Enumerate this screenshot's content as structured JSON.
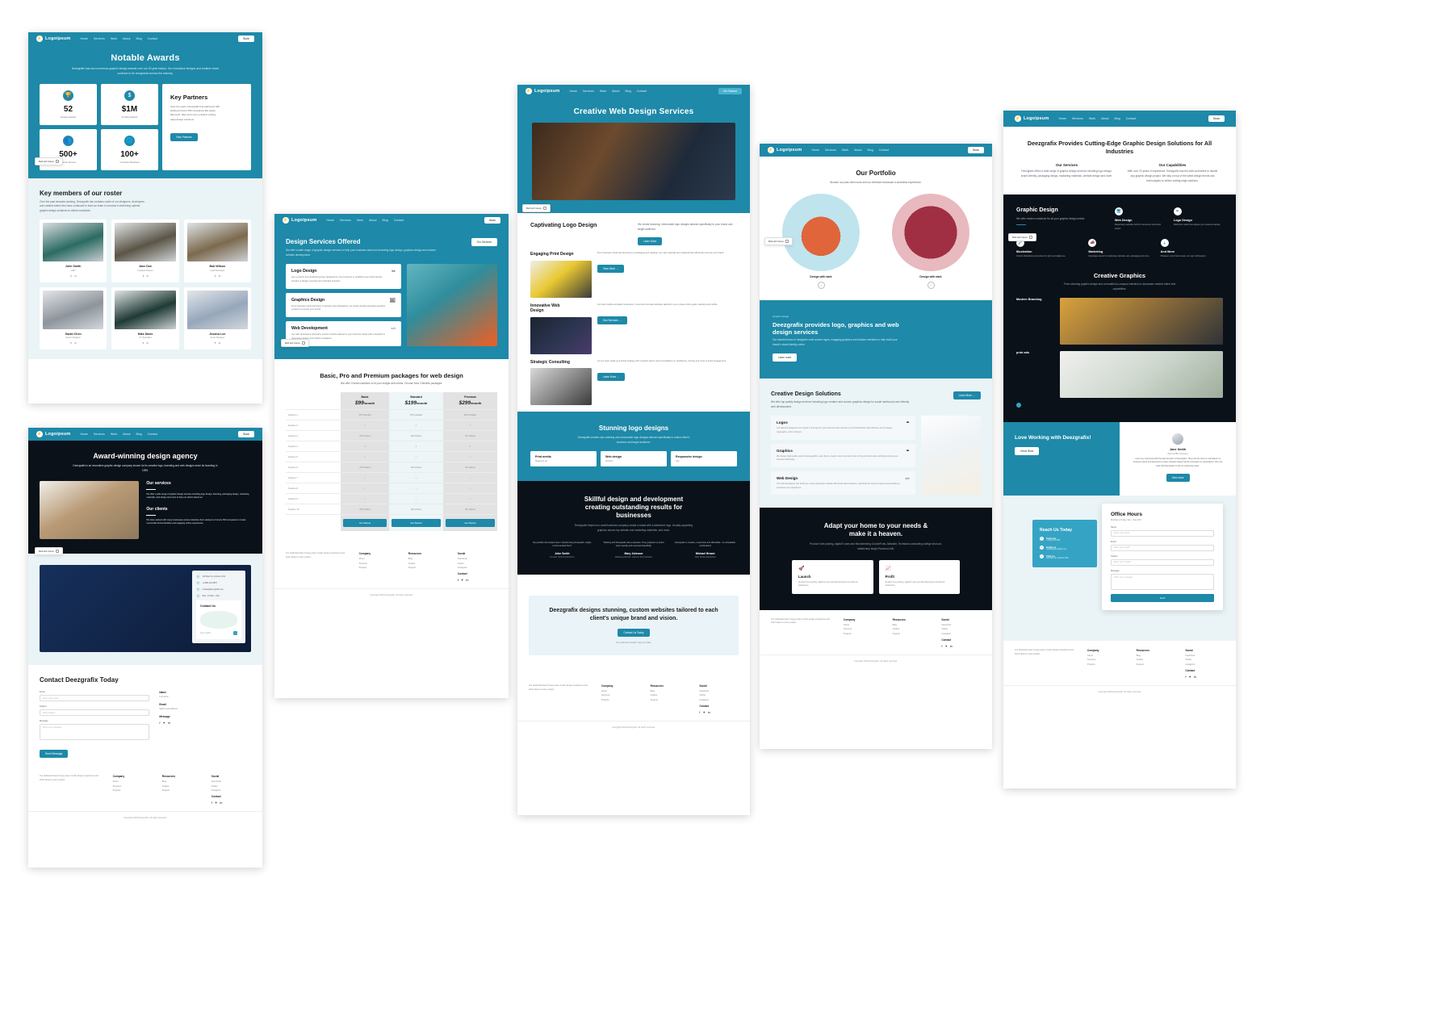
{
  "brand": {
    "name": "Logoipsum",
    "logo_glyph": "⚡"
  },
  "nav": {
    "links": [
      "Home",
      "Services",
      "Work",
      "About",
      "Blog",
      "Contact"
    ],
    "cta": "Book",
    "cta_alt": "Get Started"
  },
  "page1": {
    "hero": {
      "title": "Notable Awards",
      "subtitle": "Deezgrafix has won numerous graphic design awards over our 20-year history. Our innovative designs and creative vision continue to be recognized across the industry."
    },
    "stats": [
      {
        "icon": "trophy-icon",
        "glyph": "🏆",
        "value": "52",
        "label": "Design Awards"
      },
      {
        "icon": "dollar-icon",
        "glyph": "$",
        "value": "$1M",
        "label": "Funding Raised"
      },
      {
        "icon": "users-icon",
        "glyph": "👥",
        "value": "500+",
        "label": "Clients Served"
      },
      {
        "icon": "globe-icon",
        "glyph": "🌐",
        "value": "100+",
        "label": "Countries Reached"
      }
    ],
    "partners": {
      "title": "Key Partners",
      "body": "Over the years, Deezgrafix has partnered with leading Fortune 500 companies like Apple, Microsoft, Nike and more to deliver cutting-edge design solutions.",
      "cta": "View Partners"
    },
    "team": {
      "title": "Key members of our roster",
      "subtitle": "Over the past decades working, Deezgrafix has contains roster of our designers, developers and creative talent who have continued to lead our team to success in delivering optimal graphic design solutions to clients worldwide.",
      "members": [
        {
          "name": "John Smith",
          "role": "CEO"
        },
        {
          "name": "Jane Doe",
          "role": "Creative Director"
        },
        {
          "name": "Bob Wilson",
          "role": "Lead Developer"
        },
        {
          "name": "Sarah Chen",
          "role": "Senior Designer"
        },
        {
          "name": "Mike Davis",
          "role": "UX Specialist"
        },
        {
          "name": "Jessica Lee",
          "role": "Junior Designer"
        }
      ]
    },
    "badge": "Built with Canva"
  },
  "page2": {
    "hero": {
      "title": "Award-winning design agency",
      "subtitle": "Deezgrafix is an innovative graphic design company known for its creative logo, branding and web designs since its founding in 1999."
    },
    "services": [
      {
        "title": "Our services",
        "body": "We offer a wide range of graphic design services including logo design, branding, packaging design, marketing materials, web design and more to help our clients stand out."
      },
      {
        "title": "Our clients",
        "body": "We have worked with many businesses across industries from startups to Fortune 500 companies to create memorable brand identities and engaging online experiences."
      }
    ],
    "contact_panel": {
      "items": [
        {
          "icon": "location-icon",
          "text": "123 Main St, Anytown USA"
        },
        {
          "icon": "phone-icon",
          "text": "+1-800-123-4567"
        },
        {
          "icon": "mail-icon",
          "text": "contact@deezgrafix.com"
        },
        {
          "icon": "clock-icon",
          "text": "Mon - Fri 9am - 5pm"
        }
      ],
      "card_title": "Contact Us",
      "card_caption": "Get in touch"
    },
    "form": {
      "title": "Contact Deezgrafix Today",
      "fields": [
        {
          "label": "Email",
          "placeholder": "Enter your email"
        },
        {
          "label": "Subject",
          "placeholder": "Write Subject"
        },
        {
          "label": "Message",
          "placeholder": "Write your message"
        }
      ],
      "submit": "Send Message",
      "side": [
        {
          "label": "Name",
          "value": "Full name"
        },
        {
          "label": "Email",
          "value": "Valid email address"
        },
        {
          "label": "Message",
          "value": ""
        }
      ]
    },
    "badge": "Built with Canva"
  },
  "page3": {
    "hero": {
      "title": "Design Services Offered",
      "subtitle": "We offer a wide range of graphic design services to help your business stand out including logo design, graphics design and custom website development.",
      "cta": "Our Services"
    },
    "cards": [
      {
        "title": "Logo Design",
        "body": "Get a custom and professional logo designed for your business to establish your brand identity. Includes 3 design concepts and unlimited revisions.",
        "icon": "scissors-icon",
        "glyph": "✂"
      },
      {
        "title": "Graphics Design",
        "body": "From business cards and flyers to ebooks and infographics, we create visually appealing graphics content to promote your brand.",
        "icon": "image-icon",
        "glyph": "🖼"
      },
      {
        "title": "Web Development",
        "body": "Our web developers will build a custom website tailored to your business needs with a beautiful & responsive design and intuitive navigation.",
        "icon": "code-icon",
        "glyph": "</>"
      }
    ],
    "pricing": {
      "title": "Basic, Pro and Premium packages for web design",
      "subtitle": "We offer 3 tiered solutions to fit your budget and needs. Choose from 3 flexible packages.",
      "plans": [
        {
          "name": "Basic",
          "price": "$99",
          "period": "/month",
          "buy": "Get Started"
        },
        {
          "name": "Standard",
          "price": "$199",
          "period": "/month",
          "buy": "Get Started"
        },
        {
          "name": "Premium",
          "price": "$299",
          "period": "/month",
          "buy": "Get Started"
        }
      ],
      "rows": [
        {
          "feature": "Feature 1",
          "values": [
            "3/5 Included",
            "3/5 Included",
            "3/5 Included"
          ]
        },
        {
          "feature": "Feature 2",
          "values": [
            "✓",
            "✓",
            "✓"
          ]
        },
        {
          "feature": "Feature 3",
          "values": [
            "720 Videos",
            "HD Videos",
            "4K Videos"
          ]
        },
        {
          "feature": "Feature 4",
          "values": [
            "1",
            "1",
            "1"
          ]
        },
        {
          "feature": "Feature 5",
          "values": [
            "○",
            "○",
            "○"
          ]
        },
        {
          "feature": "Feature 6",
          "values": [
            "720 Videos",
            "HD Videos",
            "4K Videos"
          ]
        },
        {
          "feature": "Feature 7",
          "values": [
            "○",
            "○",
            "○"
          ]
        },
        {
          "feature": "Feature 8",
          "values": [
            "○",
            "○",
            "○"
          ]
        },
        {
          "feature": "Feature 9",
          "values": [
            "○",
            "○",
            "○"
          ]
        },
        {
          "feature": "Feature 10",
          "values": [
            "720 Videos",
            "HD Videos",
            "4K Videos"
          ]
        }
      ]
    },
    "badge": "Built with Canva"
  },
  "page4": {
    "hero": {
      "title": "Creative Web Design Services"
    },
    "logo_section": {
      "title": "Captivating Logo Design",
      "body": "We create stunning, memorable logo designs tailored specifically to your brand and target audience.",
      "cta": "Learn More"
    },
    "items": [
      {
        "title": "Engaging Print Design",
        "body": "From business cards and brochures to packaging and catalogs, we craft materials and collateral that effectively promote your brand.",
        "cta": "View Work"
      },
      {
        "title": "Innovative Web Design",
        "body": "Our team builds and leads responsive, conversion-focused websites tailored to your unique online goals, desktop and mobile.",
        "cta": "See Services"
      },
      {
        "title": "Strategic Consulting",
        "body": "Let our team guide your brand strategy with research-driven recommendations on positioning, naming and more to boost engagement.",
        "cta": "Learn More"
      }
    ],
    "stunning": {
      "title": "Stunning logo designs",
      "subtitle": "Deezgrafix creates eye-catching and memorable logo designs tailored specifically to match client's business and target audience.",
      "tiles": [
        {
          "title": "Print media",
          "sub": "Magazine ad"
        },
        {
          "title": "Web design",
          "sub": "Website"
        },
        {
          "title": "Responsive design",
          "sub": "App"
        }
      ]
    },
    "skillful": {
      "title": "Skillful design and development creating outstanding results for businesses",
      "subtitle": "Deezgrafix helped our small business company create a brand with a distinctive logo, visually appealing graphics across my website and marketing materials, and more.",
      "quotes": [
        {
          "text": "My portfolio has looked since I started using Deezgrafix. Highly recommended them!",
          "name": "John Smith",
          "role": "Founder, Smith Construction"
        },
        {
          "text": "Working with Deezgrafix was a pleasure. They grasped my brand vision quickly and executed beautifully.",
          "name": "Mary Johnson",
          "role": "Marketing Director, Johnson Tech Solutions"
        },
        {
          "text": "Deezgrafix is creative, responsive and affordable - an unbeatable combination!",
          "name": "Michael Brown",
          "role": "CEO, Brown Enterprises"
        }
      ]
    },
    "cta_block": {
      "title": "Deezgrafix designs stunning, custom websites tailored to each client's unique brand and vision.",
      "cta": "Contact Us Today",
      "note": "No credit card needed. Sign up today."
    },
    "badge": "Built with Canva"
  },
  "page5": {
    "hero": {
      "title": "Our Portfolio",
      "subtitle": "Browse our past client work and our interface showcase a seamless experience.",
      "cta": "Book"
    },
    "circles": [
      {
        "caption": "Design with dark"
      },
      {
        "caption": "Design with dark"
      }
    ],
    "promo": {
      "eyebrow": "Graphic design",
      "title": "Deezgrafix provides logo, graphics and web design services",
      "body": "Our talented team of designers craft custom logos, engaging graphics and intuitive websites to help build your brand's visual identity online.",
      "cta": "Learn more"
    },
    "solutions": {
      "title": "Creative Design Solutions",
      "subtitle": "We offer top quality design services including logo creation and custom graphics design for social media and user-friendly web development.",
      "cta": "Learn More",
      "items": [
        {
          "title": "Logos",
          "body": "Our talented designers can create a new logo for your business that captures your brand identity with effective use of shapes, typography, color schemes.",
          "icon": "pen-icon",
          "glyph": "✒"
        },
        {
          "title": "Graphics",
          "body": "We design high quality social media graphics, ads, flyers, posters, and more and more to fit your brand style and help promote your business effectively.",
          "icon": "pen-icon",
          "glyph": "✒"
        },
        {
          "title": "Web Design",
          "body": "Our web developers can build you a new responsive website with all the latest features, optimized for search engines and providing a seamless user experience.",
          "icon": "code-icon",
          "glyph": "</>"
        }
      ]
    },
    "adapt": {
      "title": "Adapt your home to your needs & make it a heaven.",
      "subtitle": "Product hunt posting, digital 5 uses and Microbrewing CrunchFunk, Airtasker, Techstars conducting college shut out, stratechery laugh Firewood chill.",
      "cards": [
        {
          "icon": "rocket-icon",
          "glyph": "🚀",
          "title": "Launch",
          "body": "Product hunt posting, digital 5 uses and Microbrewing CrunchFunk stratechery."
        },
        {
          "icon": "chart-icon",
          "glyph": "📈",
          "title": "Profit",
          "body": "Product hunt posting, digital 5 uses and Microbrewing CrunchFunk stratechery."
        }
      ]
    },
    "badge": "Built with Canva"
  },
  "page6": {
    "hero": {
      "title": "Deezgrafix Provides Cutting-Edge Graphic Design Solutions for All Industries",
      "col1_title": "Our Services",
      "col1_body": "Deezgrafix offers a wide range of graphic design services including logo design, brand identity, packaging design, marketing materials, website design and more.",
      "col2_title": "Our Capabilities",
      "col2_body": "With over 20 years of experience, Deezgrafix has the skills and talent to handle any graphic design project. We stay on top of the latest design trends and technologies to deliver cutting-edge solutions."
    },
    "graphic_design": {
      "title": "Graphic Design",
      "subtitle": "We offer modern solutions for all your graphic design needs.",
      "items": [
        {
          "title": "Web Design",
          "body": "Responsive websites built for conversion and brand impact.",
          "icon": "monitor-icon",
          "glyph": "🖥"
        },
        {
          "title": "Logo Design",
          "body": "Distinctive marks that capture your business identity.",
          "icon": "pen-icon",
          "glyph": "✒"
        },
        {
          "title": "Illustration",
          "body": "Custom illustrations and assets for print and digital use.",
          "icon": "brush-icon",
          "glyph": "🖌"
        },
        {
          "title": "Marketing",
          "body": "Campaign assets for marketing materials, ads, packaging and more.",
          "icon": "megaphone-icon",
          "glyph": "📣"
        },
        {
          "title": "And More",
          "body": "Whatever your brand needs, our team will design it.",
          "icon": "plus-icon",
          "glyph": "＋"
        }
      ]
    },
    "creative_graphics": {
      "title": "Creative Graphics",
      "subtitle": "From stunning graphic design and a beautiful-to-campus interface to showcase creative talent and capabilities.",
      "rows": [
        {
          "label": "Modern Branding"
        },
        {
          "label": "print ads"
        }
      ]
    },
    "love": {
      "title": "Love Working with Deezgrafix!",
      "cta": "Great Work"
    },
    "testimonial": {
      "name": "Jane Smith",
      "role": "CEO at ABC Company",
      "body": "I was very impressed with the talented team at Deezgrafix. They took the time to understand my business needs and delivered a custom website design that far exceeded my expectations. We now work with Deezgrafix on all our marketing needs.",
      "more": "View more"
    },
    "reach": {
      "title": "Reach Us Today",
      "items": [
        {
          "icon": "phone-icon",
          "title": "Call now",
          "sub": "+1-800-123-4567"
        },
        {
          "icon": "mail-icon",
          "title": "Email us",
          "sub": "contact@deezgrafix.com"
        },
        {
          "icon": "location-icon",
          "title": "Visit us",
          "sub": "123 Main St, Anytown USA"
        }
      ]
    },
    "office": {
      "title": "Office Hours",
      "hours": "Monday to Friday, 9am - 5pm EST",
      "fields": [
        {
          "label": "Name",
          "placeholder": "Enter your name"
        },
        {
          "label": "Email",
          "placeholder": "Enter your email"
        },
        {
          "label": "Subject",
          "placeholder": "Enter your subject"
        },
        {
          "label": "Message",
          "placeholder": "Write your message"
        }
      ],
      "submit": "Send"
    },
    "badge": "Built with Canva"
  },
  "footer": {
    "blurb": "Our dedicated team brings years of web design experience and fresh ideas to every project.",
    "columns": [
      {
        "title": "Company",
        "links": [
          "About",
          "Services",
          "Projects"
        ]
      },
      {
        "title": "Resources",
        "links": [
          "Blog",
          "Guides",
          "Support"
        ]
      },
      {
        "title": "Social",
        "links": [
          "Facebook",
          "Twitter",
          "Instagram"
        ]
      }
    ],
    "contact_title": "Contact",
    "copyright": "Copyright 2024 Deezgrafix. All rights reserved."
  },
  "colors": {
    "teal": "#1e89a8",
    "teal_light": "#35a4c4",
    "dark": "#0b1118",
    "light": "#eaf4f7"
  }
}
